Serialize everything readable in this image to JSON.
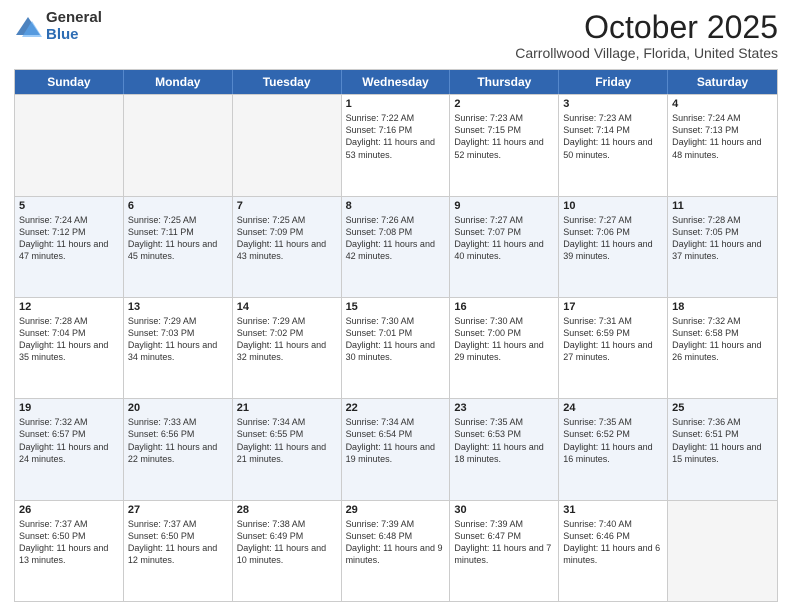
{
  "header": {
    "logo_general": "General",
    "logo_blue": "Blue",
    "month_title": "October 2025",
    "location": "Carrollwood Village, Florida, United States"
  },
  "days_of_week": [
    "Sunday",
    "Monday",
    "Tuesday",
    "Wednesday",
    "Thursday",
    "Friday",
    "Saturday"
  ],
  "weeks": [
    [
      {
        "day": "",
        "sunrise": "",
        "sunset": "",
        "daylight": "",
        "empty": true
      },
      {
        "day": "",
        "sunrise": "",
        "sunset": "",
        "daylight": "",
        "empty": true
      },
      {
        "day": "",
        "sunrise": "",
        "sunset": "",
        "daylight": "",
        "empty": true
      },
      {
        "day": "1",
        "sunrise": "Sunrise: 7:22 AM",
        "sunset": "Sunset: 7:16 PM",
        "daylight": "Daylight: 11 hours and 53 minutes.",
        "empty": false
      },
      {
        "day": "2",
        "sunrise": "Sunrise: 7:23 AM",
        "sunset": "Sunset: 7:15 PM",
        "daylight": "Daylight: 11 hours and 52 minutes.",
        "empty": false
      },
      {
        "day": "3",
        "sunrise": "Sunrise: 7:23 AM",
        "sunset": "Sunset: 7:14 PM",
        "daylight": "Daylight: 11 hours and 50 minutes.",
        "empty": false
      },
      {
        "day": "4",
        "sunrise": "Sunrise: 7:24 AM",
        "sunset": "Sunset: 7:13 PM",
        "daylight": "Daylight: 11 hours and 48 minutes.",
        "empty": false
      }
    ],
    [
      {
        "day": "5",
        "sunrise": "Sunrise: 7:24 AM",
        "sunset": "Sunset: 7:12 PM",
        "daylight": "Daylight: 11 hours and 47 minutes.",
        "empty": false
      },
      {
        "day": "6",
        "sunrise": "Sunrise: 7:25 AM",
        "sunset": "Sunset: 7:11 PM",
        "daylight": "Daylight: 11 hours and 45 minutes.",
        "empty": false
      },
      {
        "day": "7",
        "sunrise": "Sunrise: 7:25 AM",
        "sunset": "Sunset: 7:09 PM",
        "daylight": "Daylight: 11 hours and 43 minutes.",
        "empty": false
      },
      {
        "day": "8",
        "sunrise": "Sunrise: 7:26 AM",
        "sunset": "Sunset: 7:08 PM",
        "daylight": "Daylight: 11 hours and 42 minutes.",
        "empty": false
      },
      {
        "day": "9",
        "sunrise": "Sunrise: 7:27 AM",
        "sunset": "Sunset: 7:07 PM",
        "daylight": "Daylight: 11 hours and 40 minutes.",
        "empty": false
      },
      {
        "day": "10",
        "sunrise": "Sunrise: 7:27 AM",
        "sunset": "Sunset: 7:06 PM",
        "daylight": "Daylight: 11 hours and 39 minutes.",
        "empty": false
      },
      {
        "day": "11",
        "sunrise": "Sunrise: 7:28 AM",
        "sunset": "Sunset: 7:05 PM",
        "daylight": "Daylight: 11 hours and 37 minutes.",
        "empty": false
      }
    ],
    [
      {
        "day": "12",
        "sunrise": "Sunrise: 7:28 AM",
        "sunset": "Sunset: 7:04 PM",
        "daylight": "Daylight: 11 hours and 35 minutes.",
        "empty": false
      },
      {
        "day": "13",
        "sunrise": "Sunrise: 7:29 AM",
        "sunset": "Sunset: 7:03 PM",
        "daylight": "Daylight: 11 hours and 34 minutes.",
        "empty": false
      },
      {
        "day": "14",
        "sunrise": "Sunrise: 7:29 AM",
        "sunset": "Sunset: 7:02 PM",
        "daylight": "Daylight: 11 hours and 32 minutes.",
        "empty": false
      },
      {
        "day": "15",
        "sunrise": "Sunrise: 7:30 AM",
        "sunset": "Sunset: 7:01 PM",
        "daylight": "Daylight: 11 hours and 30 minutes.",
        "empty": false
      },
      {
        "day": "16",
        "sunrise": "Sunrise: 7:30 AM",
        "sunset": "Sunset: 7:00 PM",
        "daylight": "Daylight: 11 hours and 29 minutes.",
        "empty": false
      },
      {
        "day": "17",
        "sunrise": "Sunrise: 7:31 AM",
        "sunset": "Sunset: 6:59 PM",
        "daylight": "Daylight: 11 hours and 27 minutes.",
        "empty": false
      },
      {
        "day": "18",
        "sunrise": "Sunrise: 7:32 AM",
        "sunset": "Sunset: 6:58 PM",
        "daylight": "Daylight: 11 hours and 26 minutes.",
        "empty": false
      }
    ],
    [
      {
        "day": "19",
        "sunrise": "Sunrise: 7:32 AM",
        "sunset": "Sunset: 6:57 PM",
        "daylight": "Daylight: 11 hours and 24 minutes.",
        "empty": false
      },
      {
        "day": "20",
        "sunrise": "Sunrise: 7:33 AM",
        "sunset": "Sunset: 6:56 PM",
        "daylight": "Daylight: 11 hours and 22 minutes.",
        "empty": false
      },
      {
        "day": "21",
        "sunrise": "Sunrise: 7:34 AM",
        "sunset": "Sunset: 6:55 PM",
        "daylight": "Daylight: 11 hours and 21 minutes.",
        "empty": false
      },
      {
        "day": "22",
        "sunrise": "Sunrise: 7:34 AM",
        "sunset": "Sunset: 6:54 PM",
        "daylight": "Daylight: 11 hours and 19 minutes.",
        "empty": false
      },
      {
        "day": "23",
        "sunrise": "Sunrise: 7:35 AM",
        "sunset": "Sunset: 6:53 PM",
        "daylight": "Daylight: 11 hours and 18 minutes.",
        "empty": false
      },
      {
        "day": "24",
        "sunrise": "Sunrise: 7:35 AM",
        "sunset": "Sunset: 6:52 PM",
        "daylight": "Daylight: 11 hours and 16 minutes.",
        "empty": false
      },
      {
        "day": "25",
        "sunrise": "Sunrise: 7:36 AM",
        "sunset": "Sunset: 6:51 PM",
        "daylight": "Daylight: 11 hours and 15 minutes.",
        "empty": false
      }
    ],
    [
      {
        "day": "26",
        "sunrise": "Sunrise: 7:37 AM",
        "sunset": "Sunset: 6:50 PM",
        "daylight": "Daylight: 11 hours and 13 minutes.",
        "empty": false
      },
      {
        "day": "27",
        "sunrise": "Sunrise: 7:37 AM",
        "sunset": "Sunset: 6:50 PM",
        "daylight": "Daylight: 11 hours and 12 minutes.",
        "empty": false
      },
      {
        "day": "28",
        "sunrise": "Sunrise: 7:38 AM",
        "sunset": "Sunset: 6:49 PM",
        "daylight": "Daylight: 11 hours and 10 minutes.",
        "empty": false
      },
      {
        "day": "29",
        "sunrise": "Sunrise: 7:39 AM",
        "sunset": "Sunset: 6:48 PM",
        "daylight": "Daylight: 11 hours and 9 minutes.",
        "empty": false
      },
      {
        "day": "30",
        "sunrise": "Sunrise: 7:39 AM",
        "sunset": "Sunset: 6:47 PM",
        "daylight": "Daylight: 11 hours and 7 minutes.",
        "empty": false
      },
      {
        "day": "31",
        "sunrise": "Sunrise: 7:40 AM",
        "sunset": "Sunset: 6:46 PM",
        "daylight": "Daylight: 11 hours and 6 minutes.",
        "empty": false
      },
      {
        "day": "",
        "sunrise": "",
        "sunset": "",
        "daylight": "",
        "empty": true
      }
    ]
  ]
}
